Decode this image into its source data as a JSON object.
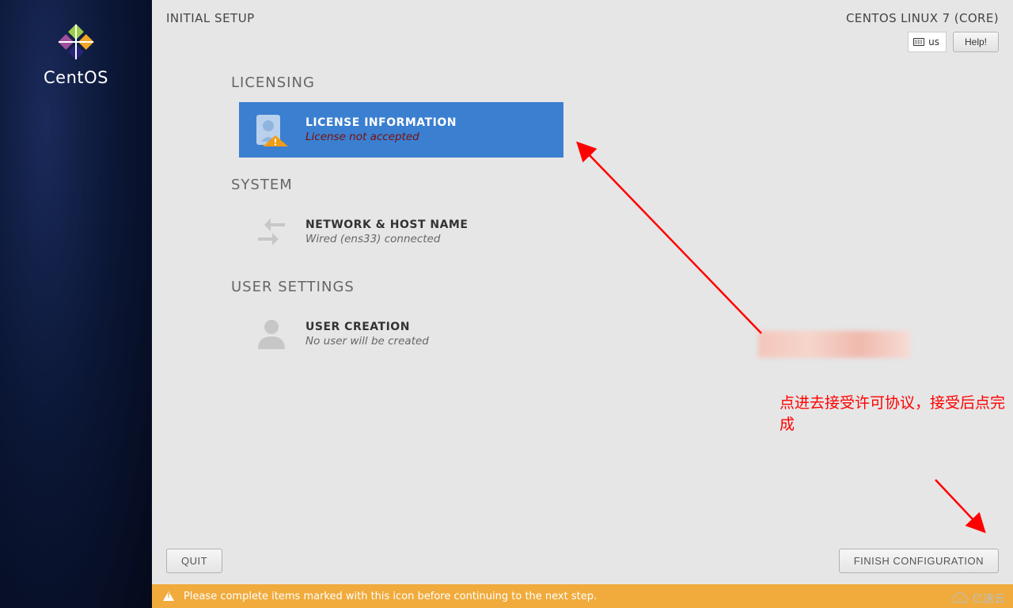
{
  "sidebar": {
    "brand": "CentOS"
  },
  "header": {
    "title": "INITIAL SETUP",
    "distro": "CENTOS LINUX 7 (CORE)",
    "keyboard_layout": "us",
    "help_label": "Help!"
  },
  "sections": {
    "licensing": {
      "title": "LICENSING",
      "license_info": {
        "title": "LICENSE INFORMATION",
        "status": "License not accepted"
      }
    },
    "system": {
      "title": "SYSTEM",
      "network": {
        "title": "NETWORK & HOST NAME",
        "status": "Wired (ens33) connected"
      }
    },
    "user_settings": {
      "title": "USER SETTINGS",
      "user_creation": {
        "title": "USER CREATION",
        "status": "No user will be created"
      }
    }
  },
  "buttons": {
    "quit": "QUIT",
    "finish": "FINISH CONFIGURATION"
  },
  "warning_bar": {
    "message": "Please complete items marked with this icon before continuing to the next step."
  },
  "annotations": {
    "hint": "点进去接受许可协议，接受后点完成"
  },
  "watermark": {
    "text": "亿速云"
  }
}
